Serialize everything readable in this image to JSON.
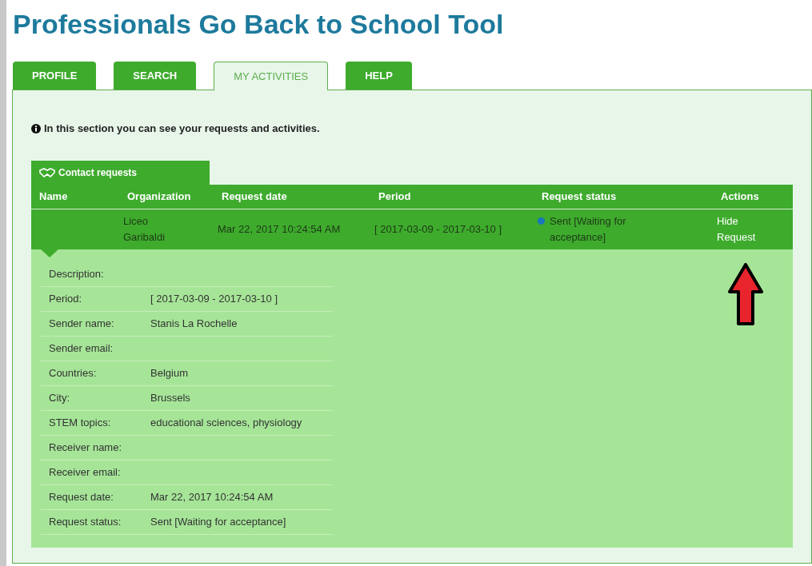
{
  "title": "Professionals Go Back to School Tool",
  "tabs": [
    {
      "label": "PROFILE",
      "selected": false
    },
    {
      "label": "SEARCH",
      "selected": false
    },
    {
      "label": "MY ACTIVITIES",
      "selected": true
    },
    {
      "label": "HELP",
      "selected": false
    }
  ],
  "info": "In this section you can see your requests and activities.",
  "section_tab": "Contact requests",
  "table": {
    "columns": [
      "Name",
      "Organization",
      "Request date",
      "Period",
      "Request status",
      "Actions"
    ],
    "rows": [
      {
        "organization": "Liceo Garibaldi",
        "request_date": "Mar 22, 2017 10:24:54 AM",
        "period": "[ 2017-03-09 - 2017-03-10 ]",
        "status": "Sent [Waiting for acceptance]",
        "color": "#1b75bb",
        "action": "Hide Request",
        "expanded": true
      }
    ]
  },
  "details": [
    {
      "label": "Description:"
    },
    {
      "label": "Period:",
      "value": "[ 2017-03-09 - 2017-03-10 ]"
    },
    {
      "label": "Sender name:",
      "value": "Stanis La Rochelle"
    },
    {
      "label": "Sender email:"
    },
    {
      "label": "Countries:",
      "value": "Belgium"
    },
    {
      "label": "City:",
      "value": "Brussels"
    },
    {
      "label": "STEM topics:",
      "value": "educational sciences, physiology"
    },
    {
      "label": "Receiver name:"
    },
    {
      "label": "Receiver email:"
    },
    {
      "label": "Request date:",
      "value": "Mar 22, 2017 10:24:54 AM"
    },
    {
      "label": "Request status:",
      "value": "Sent [Waiting for acceptance]"
    }
  ]
}
